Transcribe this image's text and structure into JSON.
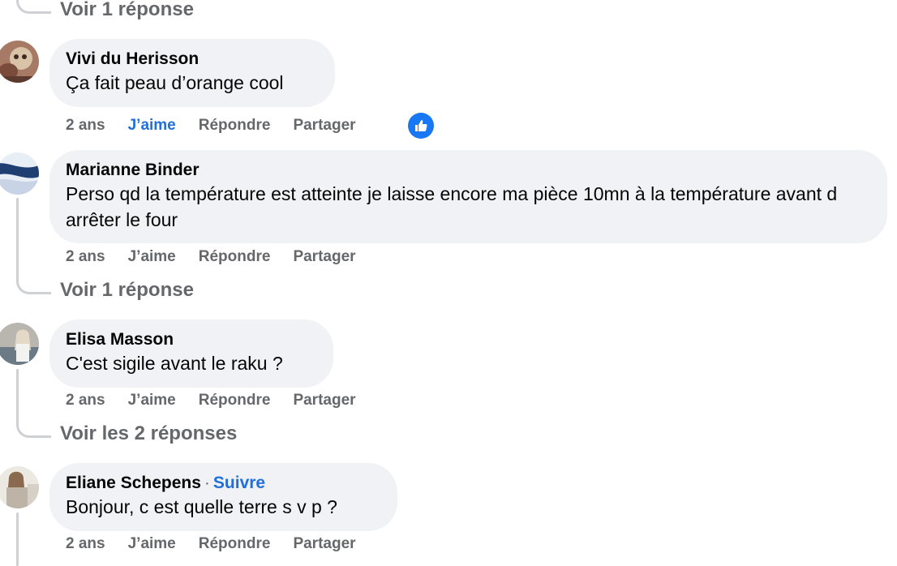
{
  "top_replies_link": "Voir 1 réponse",
  "comments": [
    {
      "author": "Vivi du Herisson",
      "text": "Ça fait peau d’orange cool",
      "time": "2 ans",
      "like": "J’aime",
      "reply": "Répondre",
      "share": "Partager",
      "liked": true,
      "reaction_icon": "thumbs-up-icon"
    },
    {
      "author": "Marianne Binder",
      "text": "Perso qd la température est atteinte je laisse encore ma pièce 10mn à la température avant d arrêter le four",
      "time": "2 ans",
      "like": "J’aime",
      "reply": "Répondre",
      "share": "Partager",
      "replies_link": "Voir 1 réponse"
    },
    {
      "author": "Elisa Masson",
      "text": "C'est sigile avant le raku ?",
      "time": "2 ans",
      "like": "J’aime",
      "reply": "Répondre",
      "share": "Partager",
      "replies_link": "Voir les 2 réponses"
    },
    {
      "author": "Eliane Schepens",
      "follow": "Suivre",
      "follow_separator": "·",
      "text": "Bonjour, c est quelle terre s v p ?",
      "time": "2 ans",
      "like": "J’aime",
      "reply": "Répondre",
      "share": "Partager"
    }
  ],
  "colors": {
    "bubble": "#f0f2f5",
    "link_blue": "#216fdb",
    "meta_gray": "#65676b",
    "thread_line": "#ced0d4",
    "reaction_blue": "#1877f2"
  }
}
